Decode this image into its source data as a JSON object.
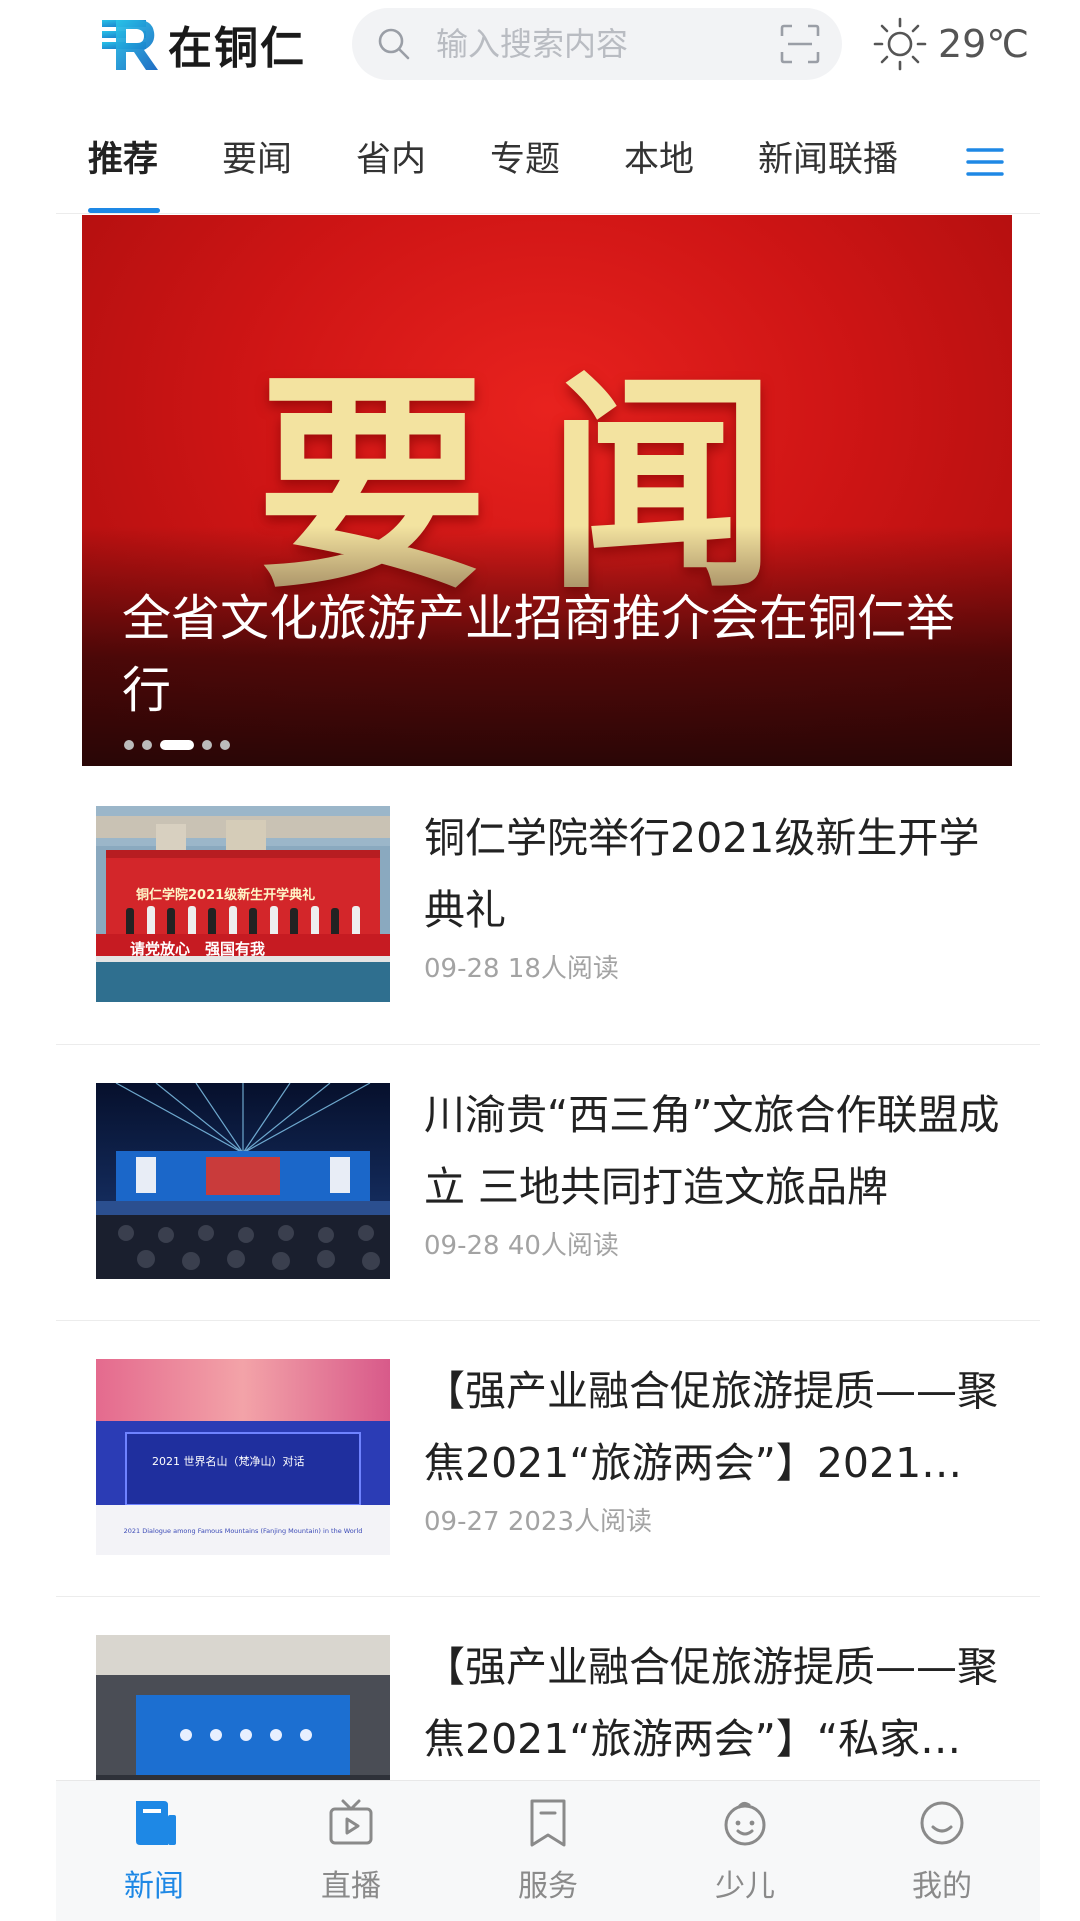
{
  "header": {
    "logo_text": "在铜仁",
    "search_placeholder": "输入搜索内容",
    "weather_temp": "29℃"
  },
  "tabs": [
    {
      "label": "推荐",
      "active": true
    },
    {
      "label": "要闻"
    },
    {
      "label": "省内"
    },
    {
      "label": "专题"
    },
    {
      "label": "本地"
    },
    {
      "label": "新闻联播"
    }
  ],
  "banner": {
    "image_text": "要闻",
    "title": "全省文化旅游产业招商推介会在铜仁举行",
    "dot_count": 5,
    "active_dot": 2
  },
  "news": [
    {
      "title": "铜仁学院举行2021级新生开学典礼",
      "date": "09-28",
      "reads": "18人阅读",
      "thumb_text": "铜仁学院2021级新生开学典礼",
      "thumb_slogan": "请党放心　强国有我"
    },
    {
      "title": "川渝贵“西三角”文旅合作联盟成立 三地共同打造文旅品牌",
      "date": "09-28",
      "reads": "40人阅读"
    },
    {
      "title": "【强产业融合促旅游提质——聚焦2021“旅游两会”】2021…",
      "date": "09-27",
      "reads": "2023人阅读",
      "thumb_text": "2021 世界名山（梵净山）对话",
      "thumb_caption": "2021 Dialogue among Famous Mountains (Fanjing Mountain) in the World"
    },
    {
      "title": "【强产业融合促旅游提质——聚焦2021“旅游两会”】“私家…",
      "date": "",
      "reads": ""
    }
  ],
  "bottom_nav": [
    {
      "label": "新闻",
      "icon": "news-icon",
      "active": true
    },
    {
      "label": "直播",
      "icon": "live-tv-icon"
    },
    {
      "label": "服务",
      "icon": "bookmark-icon"
    },
    {
      "label": "少儿",
      "icon": "kid-face-icon"
    },
    {
      "label": "我的",
      "icon": "smile-icon"
    }
  ],
  "colors": {
    "accent": "#1e88e5",
    "banner_red": "#cf1515",
    "muted_text": "#a3a3a3"
  }
}
